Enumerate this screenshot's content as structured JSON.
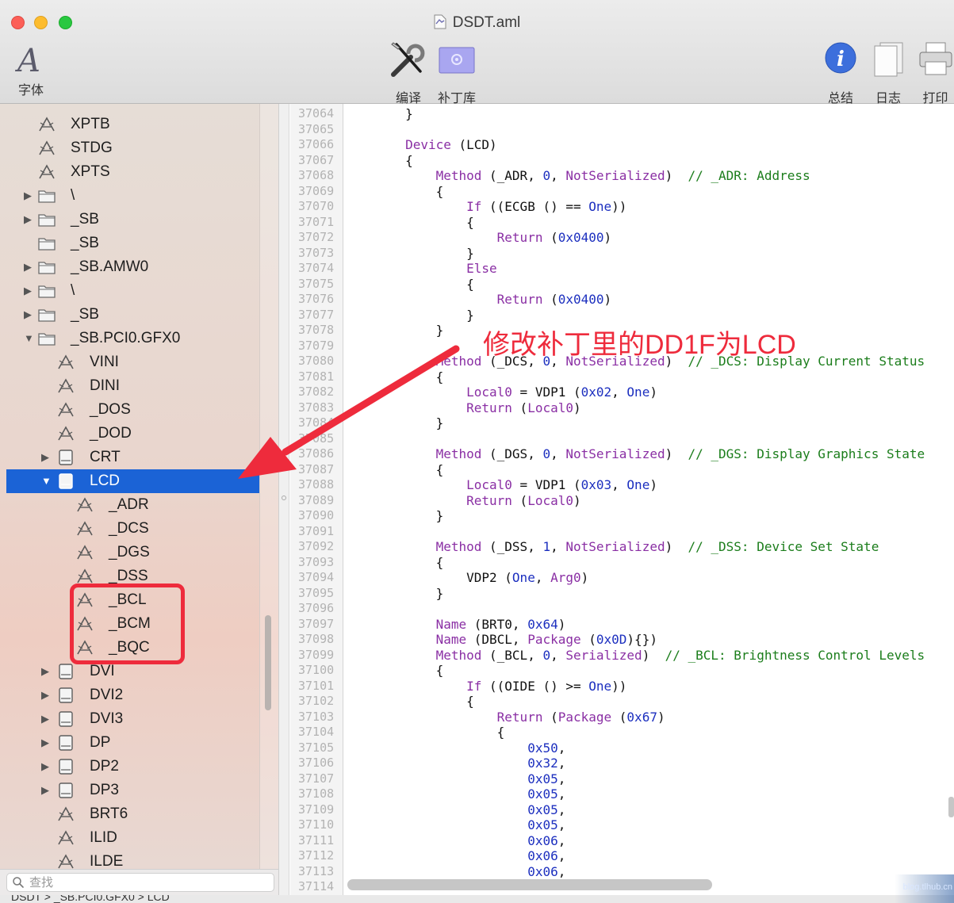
{
  "window": {
    "title": "DSDT.aml"
  },
  "toolbar": {
    "font": "字体",
    "compile": "编译",
    "patch": "补丁库",
    "summary": "总结",
    "log": "日志",
    "print": "打印"
  },
  "sidebar": {
    "rows": [
      {
        "label": "XPTB",
        "kind": "method",
        "indent": 0
      },
      {
        "label": "STDG",
        "kind": "method",
        "indent": 0
      },
      {
        "label": "XPTS",
        "kind": "method",
        "indent": 0
      },
      {
        "label": "\\",
        "kind": "folder",
        "indent": 0,
        "disclosure": "collapsed"
      },
      {
        "label": "_SB",
        "kind": "folder",
        "indent": 0,
        "disclosure": "collapsed"
      },
      {
        "label": "_SB",
        "kind": "folder",
        "indent": 0,
        "disclosure": "none"
      },
      {
        "label": "_SB.AMW0",
        "kind": "folder",
        "indent": 0,
        "disclosure": "collapsed"
      },
      {
        "label": "\\",
        "kind": "folder",
        "indent": 0,
        "disclosure": "collapsed"
      },
      {
        "label": "_SB",
        "kind": "folder",
        "indent": 0,
        "disclosure": "collapsed"
      },
      {
        "label": "_SB.PCI0.GFX0",
        "kind": "folder",
        "indent": 0,
        "disclosure": "expanded"
      },
      {
        "label": "VINI",
        "kind": "method",
        "indent": 1
      },
      {
        "label": "DINI",
        "kind": "method",
        "indent": 1
      },
      {
        "label": "_DOS",
        "kind": "method",
        "indent": 1
      },
      {
        "label": "_DOD",
        "kind": "method",
        "indent": 1
      },
      {
        "label": "CRT",
        "kind": "device",
        "indent": 1,
        "disclosure": "collapsed"
      },
      {
        "label": "LCD",
        "kind": "device",
        "indent": 1,
        "disclosure": "expanded",
        "selected": true
      },
      {
        "label": "_ADR",
        "kind": "method",
        "indent": 2
      },
      {
        "label": "_DCS",
        "kind": "method",
        "indent": 2
      },
      {
        "label": "_DGS",
        "kind": "method",
        "indent": 2
      },
      {
        "label": "_DSS",
        "kind": "method",
        "indent": 2
      },
      {
        "label": "_BCL",
        "kind": "method",
        "indent": 2
      },
      {
        "label": "_BCM",
        "kind": "method",
        "indent": 2
      },
      {
        "label": "_BQC",
        "kind": "method",
        "indent": 2
      },
      {
        "label": "DVI",
        "kind": "device",
        "indent": 1,
        "disclosure": "collapsed"
      },
      {
        "label": "DVI2",
        "kind": "device",
        "indent": 1,
        "disclosure": "collapsed"
      },
      {
        "label": "DVI3",
        "kind": "device",
        "indent": 1,
        "disclosure": "collapsed"
      },
      {
        "label": "DP",
        "kind": "device",
        "indent": 1,
        "disclosure": "collapsed"
      },
      {
        "label": "DP2",
        "kind": "device",
        "indent": 1,
        "disclosure": "collapsed"
      },
      {
        "label": "DP3",
        "kind": "device",
        "indent": 1,
        "disclosure": "collapsed"
      },
      {
        "label": "BRT6",
        "kind": "method",
        "indent": 1
      },
      {
        "label": "ILID",
        "kind": "method",
        "indent": 1
      },
      {
        "label": "ILDE",
        "kind": "method",
        "indent": 1
      }
    ],
    "search_placeholder": "查找"
  },
  "annotation": "修改补丁里的DD1F为LCD",
  "statusbar": "DSDT > _SB.PCI0.GFX0 > LCD",
  "watermark": "blog.tlhub.cn",
  "editor": {
    "first_line": 37064,
    "lines": [
      [
        [
          "t",
          "        }"
        ]
      ],
      [
        [
          "t",
          ""
        ]
      ],
      [
        [
          "t",
          "        "
        ],
        [
          "k",
          "Device"
        ],
        [
          "t",
          " (LCD)"
        ]
      ],
      [
        [
          "t",
          "        {"
        ]
      ],
      [
        [
          "t",
          "            "
        ],
        [
          "k",
          "Method"
        ],
        [
          "t",
          " (_ADR, "
        ],
        [
          "n",
          "0"
        ],
        [
          "t",
          ", "
        ],
        [
          "k",
          "NotSerialized"
        ],
        [
          "t",
          ")  "
        ],
        [
          "c",
          "// _ADR: Address"
        ]
      ],
      [
        [
          "t",
          "            {"
        ]
      ],
      [
        [
          "t",
          "                "
        ],
        [
          "k",
          "If"
        ],
        [
          "t",
          " ((ECGB () == "
        ],
        [
          "n",
          "One"
        ],
        [
          "t",
          "))"
        ]
      ],
      [
        [
          "t",
          "                {"
        ]
      ],
      [
        [
          "t",
          "                    "
        ],
        [
          "k",
          "Return"
        ],
        [
          "t",
          " ("
        ],
        [
          "n",
          "0x0400"
        ],
        [
          "t",
          ")"
        ]
      ],
      [
        [
          "t",
          "                }"
        ]
      ],
      [
        [
          "t",
          "                "
        ],
        [
          "k",
          "Else"
        ]
      ],
      [
        [
          "t",
          "                {"
        ]
      ],
      [
        [
          "t",
          "                    "
        ],
        [
          "k",
          "Return"
        ],
        [
          "t",
          " ("
        ],
        [
          "n",
          "0x0400"
        ],
        [
          "t",
          ")"
        ]
      ],
      [
        [
          "t",
          "                }"
        ]
      ],
      [
        [
          "t",
          "            }"
        ]
      ],
      [
        [
          "t",
          ""
        ]
      ],
      [
        [
          "t",
          "            "
        ],
        [
          "k",
          "Method"
        ],
        [
          "t",
          " (_DCS, "
        ],
        [
          "n",
          "0"
        ],
        [
          "t",
          ", "
        ],
        [
          "k",
          "NotSerialized"
        ],
        [
          "t",
          ")  "
        ],
        [
          "c",
          "// _DCS: Display Current Status"
        ]
      ],
      [
        [
          "t",
          "            {"
        ]
      ],
      [
        [
          "t",
          "                "
        ],
        [
          "k",
          "Local0"
        ],
        [
          "t",
          " = VDP1 ("
        ],
        [
          "n",
          "0x02"
        ],
        [
          "t",
          ", "
        ],
        [
          "n",
          "One"
        ],
        [
          "t",
          ")"
        ]
      ],
      [
        [
          "t",
          "                "
        ],
        [
          "k",
          "Return"
        ],
        [
          "t",
          " ("
        ],
        [
          "k",
          "Local0"
        ],
        [
          "t",
          ")"
        ]
      ],
      [
        [
          "t",
          "            }"
        ]
      ],
      [
        [
          "t",
          ""
        ]
      ],
      [
        [
          "t",
          "            "
        ],
        [
          "k",
          "Method"
        ],
        [
          "t",
          " (_DGS, "
        ],
        [
          "n",
          "0"
        ],
        [
          "t",
          ", "
        ],
        [
          "k",
          "NotSerialized"
        ],
        [
          "t",
          ")  "
        ],
        [
          "c",
          "// _DGS: Display Graphics State"
        ]
      ],
      [
        [
          "t",
          "            {"
        ]
      ],
      [
        [
          "t",
          "                "
        ],
        [
          "k",
          "Local0"
        ],
        [
          "t",
          " = VDP1 ("
        ],
        [
          "n",
          "0x03"
        ],
        [
          "t",
          ", "
        ],
        [
          "n",
          "One"
        ],
        [
          "t",
          ")"
        ]
      ],
      [
        [
          "t",
          "                "
        ],
        [
          "k",
          "Return"
        ],
        [
          "t",
          " ("
        ],
        [
          "k",
          "Local0"
        ],
        [
          "t",
          ")"
        ]
      ],
      [
        [
          "t",
          "            }"
        ]
      ],
      [
        [
          "t",
          ""
        ]
      ],
      [
        [
          "t",
          "            "
        ],
        [
          "k",
          "Method"
        ],
        [
          "t",
          " (_DSS, "
        ],
        [
          "n",
          "1"
        ],
        [
          "t",
          ", "
        ],
        [
          "k",
          "NotSerialized"
        ],
        [
          "t",
          ")  "
        ],
        [
          "c",
          "// _DSS: Device Set State"
        ]
      ],
      [
        [
          "t",
          "            {"
        ]
      ],
      [
        [
          "t",
          "                VDP2 ("
        ],
        [
          "n",
          "One"
        ],
        [
          "t",
          ", "
        ],
        [
          "k",
          "Arg0"
        ],
        [
          "t",
          ")"
        ]
      ],
      [
        [
          "t",
          "            }"
        ]
      ],
      [
        [
          "t",
          ""
        ]
      ],
      [
        [
          "t",
          "            "
        ],
        [
          "k",
          "Name"
        ],
        [
          "t",
          " (BRT0, "
        ],
        [
          "n",
          "0x64"
        ],
        [
          "t",
          ")"
        ]
      ],
      [
        [
          "t",
          "            "
        ],
        [
          "k",
          "Name"
        ],
        [
          "t",
          " (DBCL, "
        ],
        [
          "k",
          "Package"
        ],
        [
          "t",
          " ("
        ],
        [
          "n",
          "0x0D"
        ],
        [
          "t",
          "){})"
        ]
      ],
      [
        [
          "t",
          "            "
        ],
        [
          "k",
          "Method"
        ],
        [
          "t",
          " (_BCL, "
        ],
        [
          "n",
          "0"
        ],
        [
          "t",
          ", "
        ],
        [
          "k",
          "Serialized"
        ],
        [
          "t",
          ")  "
        ],
        [
          "c",
          "// _BCL: Brightness Control Levels"
        ]
      ],
      [
        [
          "t",
          "            {"
        ]
      ],
      [
        [
          "t",
          "                "
        ],
        [
          "k",
          "If"
        ],
        [
          "t",
          " ((OIDE () >= "
        ],
        [
          "n",
          "One"
        ],
        [
          "t",
          "))"
        ]
      ],
      [
        [
          "t",
          "                {"
        ]
      ],
      [
        [
          "t",
          "                    "
        ],
        [
          "k",
          "Return"
        ],
        [
          "t",
          " ("
        ],
        [
          "k",
          "Package"
        ],
        [
          "t",
          " ("
        ],
        [
          "n",
          "0x67"
        ],
        [
          "t",
          ")"
        ]
      ],
      [
        [
          "t",
          "                    {"
        ]
      ],
      [
        [
          "t",
          "                        "
        ],
        [
          "n",
          "0x50"
        ],
        [
          "t",
          ","
        ]
      ],
      [
        [
          "t",
          "                        "
        ],
        [
          "n",
          "0x32"
        ],
        [
          "t",
          ","
        ]
      ],
      [
        [
          "t",
          "                        "
        ],
        [
          "n",
          "0x05"
        ],
        [
          "t",
          ","
        ]
      ],
      [
        [
          "t",
          "                        "
        ],
        [
          "n",
          "0x05"
        ],
        [
          "t",
          ","
        ]
      ],
      [
        [
          "t",
          "                        "
        ],
        [
          "n",
          "0x05"
        ],
        [
          "t",
          ","
        ]
      ],
      [
        [
          "t",
          "                        "
        ],
        [
          "n",
          "0x05"
        ],
        [
          "t",
          ","
        ]
      ],
      [
        [
          "t",
          "                        "
        ],
        [
          "n",
          "0x06"
        ],
        [
          "t",
          ","
        ]
      ],
      [
        [
          "t",
          "                        "
        ],
        [
          "n",
          "0x06"
        ],
        [
          "t",
          ","
        ]
      ],
      [
        [
          "t",
          "                        "
        ],
        [
          "n",
          "0x06"
        ],
        [
          "t",
          ","
        ]
      ],
      [
        [
          "t",
          ""
        ]
      ]
    ]
  },
  "colors": {
    "selection": "#1b63d6",
    "keyword": "#8a2fa4",
    "number": "#1c2fbf",
    "comment": "#1b7d1b",
    "annotation": "#ee2b3c"
  }
}
